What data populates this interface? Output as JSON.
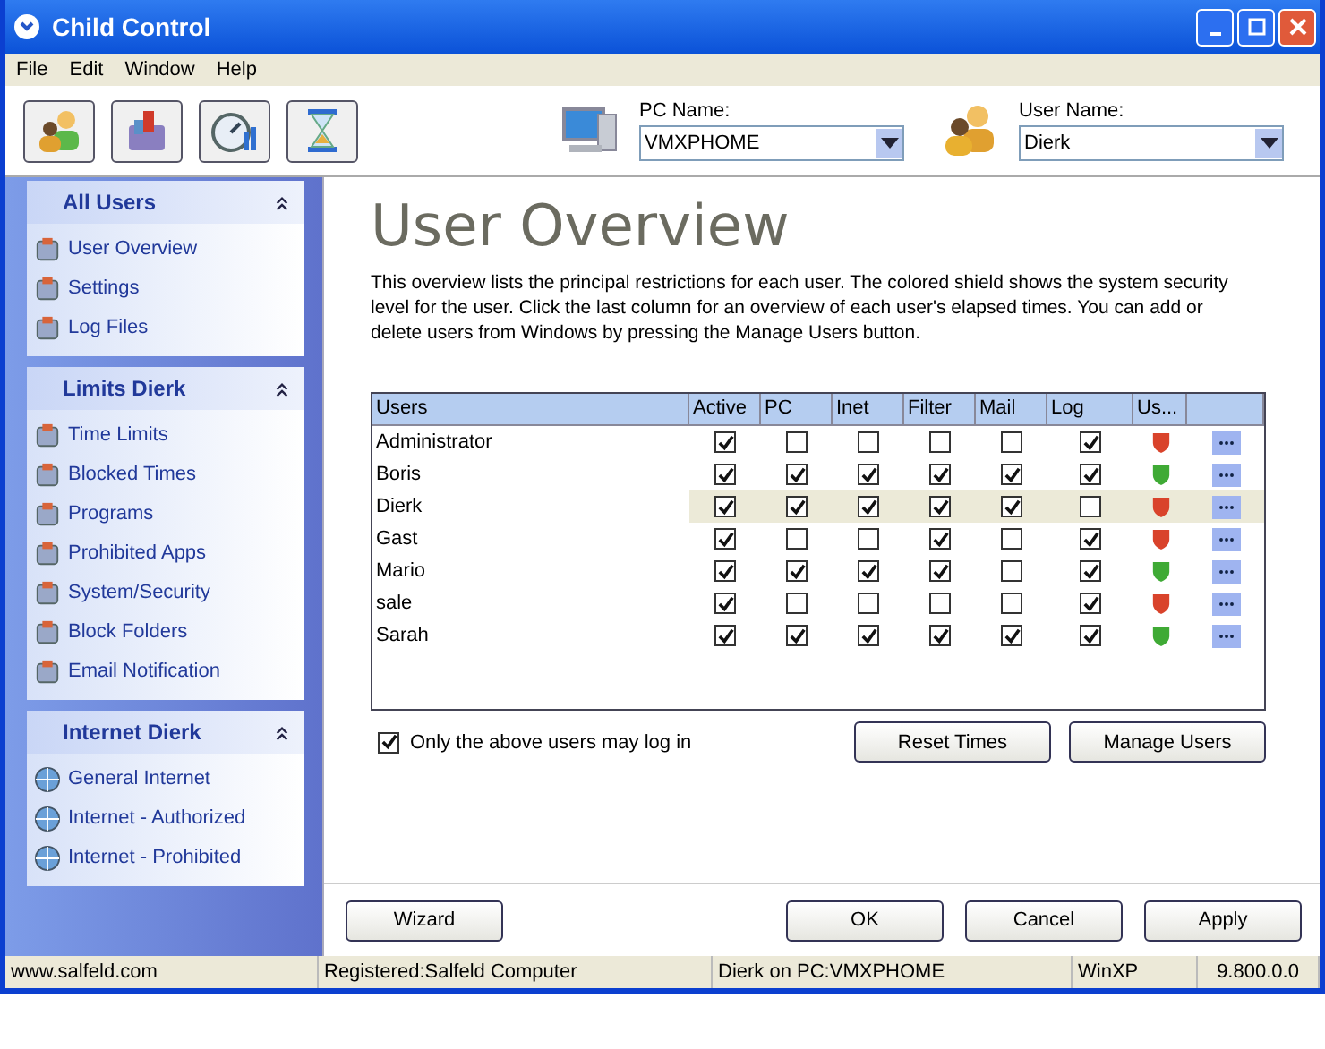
{
  "window": {
    "title": "Child Control"
  },
  "menu": [
    "File",
    "Edit",
    "Window",
    "Help"
  ],
  "pc_name": {
    "label": "PC Name:",
    "value": "VMXPHOME"
  },
  "user_name": {
    "label": "User Name:",
    "value": "Dierk"
  },
  "sidebar": [
    {
      "title": "All Users",
      "items": [
        "User Overview",
        "Settings",
        "Log Files"
      ]
    },
    {
      "title": "Limits Dierk",
      "items": [
        "Time Limits",
        "Blocked Times",
        "Programs",
        "Prohibited Apps",
        "System/Security",
        "Block Folders",
        "Email Notification"
      ]
    },
    {
      "title": "Internet Dierk",
      "items": [
        "General Internet",
        "Internet - Authorized",
        "Internet - Prohibited"
      ]
    }
  ],
  "heading": "User Overview",
  "description": "This overview lists the principal restrictions for each user. The colored shield shows the system security level for the user. Click the last column for an overview of each user's elapsed times. You can add or delete users from Windows by pressing the Manage Users button.",
  "table": {
    "columns": [
      "Users",
      "Active",
      "PC",
      "Inet",
      "Filter",
      "Mail",
      "Log",
      "Us..."
    ],
    "rows": [
      {
        "name": "Administrator",
        "checks": [
          true,
          false,
          false,
          false,
          false,
          true
        ],
        "color": "#d9432b",
        "selected": false
      },
      {
        "name": "Boris",
        "checks": [
          true,
          true,
          true,
          true,
          true,
          true
        ],
        "color": "#3faa35",
        "selected": false
      },
      {
        "name": "Dierk",
        "checks": [
          true,
          true,
          true,
          true,
          true,
          false
        ],
        "color": "#d9432b",
        "selected": true
      },
      {
        "name": "Gast",
        "checks": [
          true,
          false,
          false,
          true,
          false,
          true
        ],
        "color": "#d9432b",
        "selected": false
      },
      {
        "name": "Mario",
        "checks": [
          true,
          true,
          true,
          true,
          false,
          true
        ],
        "color": "#3faa35",
        "selected": false
      },
      {
        "name": "sale",
        "checks": [
          true,
          false,
          false,
          false,
          false,
          true
        ],
        "color": "#d9432b",
        "selected": false
      },
      {
        "name": "Sarah",
        "checks": [
          true,
          true,
          true,
          true,
          true,
          true
        ],
        "color": "#3faa35",
        "selected": false
      }
    ]
  },
  "only_above": {
    "label": "Only the above users may log in",
    "checked": true
  },
  "table_buttons": [
    "Reset Times",
    "Manage Users"
  ],
  "wizard": "Wizard",
  "footer_buttons": [
    "OK",
    "Cancel",
    "Apply"
  ],
  "status_bar": [
    "www.salfeld.com",
    "Registered:Salfeld Computer",
    "Dierk on PC:VMXPHOME",
    "WinXP",
    "9.800.0.0"
  ]
}
